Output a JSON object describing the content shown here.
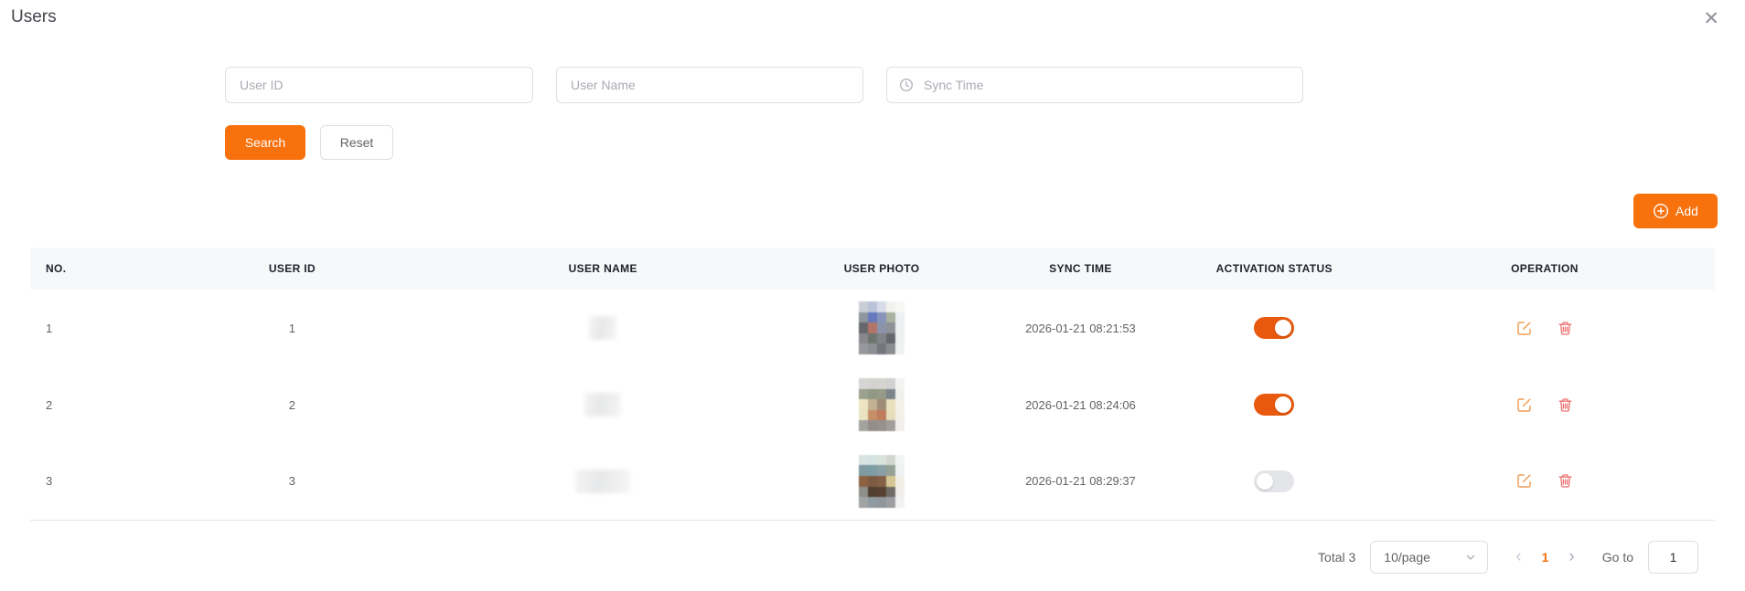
{
  "page": {
    "title": "Users"
  },
  "icons": {
    "close": "✕",
    "page_prev": "‹",
    "page_next": "›"
  },
  "filters": {
    "user_id": {
      "placeholder": "User ID",
      "value": ""
    },
    "user_name": {
      "placeholder": "User Name",
      "value": ""
    },
    "sync_time": {
      "placeholder": "Sync Time",
      "value": ""
    },
    "search_label": "Search",
    "reset_label": "Reset"
  },
  "toolbar": {
    "add_label": "Add"
  },
  "table": {
    "columns": [
      "NO.",
      "USER ID",
      "USER NAME",
      "USER PHOTO",
      "SYNC TIME",
      "ACTIVATION STATUS",
      "OPERATION"
    ],
    "rows": [
      {
        "no": "1",
        "user_id": "1",
        "name_blur_width": 30,
        "sync_time": "2026-01-21 08:21:53",
        "activation_on": true,
        "photo_pixels": [
          "#c9cdd6",
          "#bac3d8",
          "#d8dce9",
          "#f1f1ed",
          "#f6f6f4",
          "#8e959e",
          "#6679bd",
          "#8894bb",
          "#a9b1a1",
          "#edeff0",
          "#65676c",
          "#b3756a",
          "#8c94a9",
          "#8f9296",
          "#edeff0",
          "#87898c",
          "#6e7571",
          "#808488",
          "#64676b",
          "#eef0f0",
          "#98999c",
          "#8c8f93",
          "#73777c",
          "#8b8e91",
          "#f0f1f1"
        ]
      },
      {
        "no": "2",
        "user_id": "2",
        "name_blur_width": 40,
        "sync_time": "2026-01-21 08:24:06",
        "activation_on": true,
        "photo_pixels": [
          "#d5d5d3",
          "#d3d3d0",
          "#d5d4d1",
          "#d0d1d0",
          "#f3f3f2",
          "#9ba18e",
          "#909984",
          "#959b87",
          "#7e848b",
          "#eff1ef",
          "#ede5c2",
          "#c4b193",
          "#a08d77",
          "#e9e0be",
          "#f3f1e9",
          "#eae3c1",
          "#c78f68",
          "#be7d5d",
          "#e6ddbb",
          "#f2f0e7",
          "#a4a29d",
          "#938d89",
          "#97918d",
          "#a19e9a",
          "#f1f0ef"
        ]
      },
      {
        "no": "3",
        "user_id": "3",
        "name_blur_width": 60,
        "sync_time": "2026-01-21 08:29:37",
        "activation_on": false,
        "photo_pixels": [
          "#d8e4e2",
          "#d4e3e1",
          "#d9e3db",
          "#d4d7d0",
          "#f2f4f3",
          "#7f9aa1",
          "#7e9ca4",
          "#8aa0a4",
          "#94a195",
          "#eff2f2",
          "#8b6344",
          "#7d5b42",
          "#846047",
          "#d4c795",
          "#f1eee5",
          "#8e8e8a",
          "#513f2f",
          "#564130",
          "#706b65",
          "#efeeec",
          "#a1a4a5",
          "#8f9ba1",
          "#91969b",
          "#9c9ea1",
          "#f1f2f3"
        ]
      }
    ]
  },
  "pagination": {
    "total_label": "Total 3",
    "page_size_label": "10/page",
    "current_page": "1",
    "goto_label": "Go to",
    "goto_value": "1"
  },
  "colors": {
    "primary_orange": "#f7710d",
    "toggle_on": "#e8590d",
    "edit_icon": "#f09a51",
    "delete_icon": "#ec7171",
    "page_active": "#f7710d"
  }
}
